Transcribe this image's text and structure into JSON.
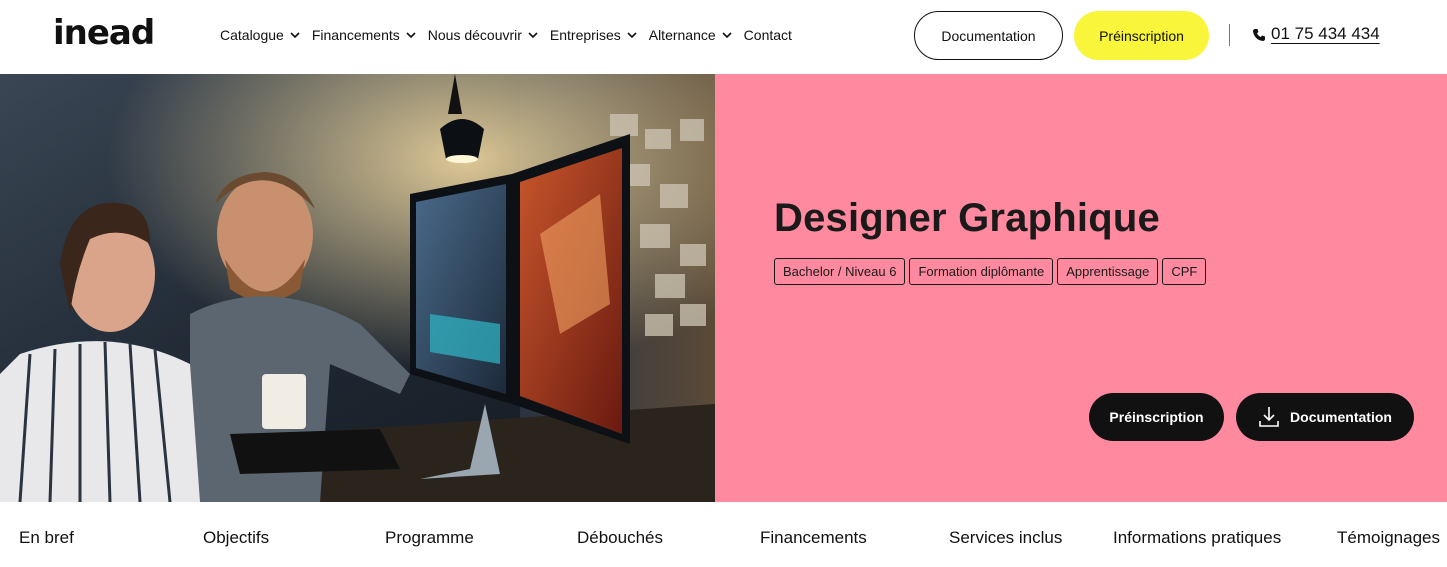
{
  "header": {
    "logo_text": "inead",
    "nav": [
      {
        "label": "Catalogue",
        "dropdown": true
      },
      {
        "label": "Financements",
        "dropdown": true
      },
      {
        "label": "Nous découvrir",
        "dropdown": true
      },
      {
        "label": "Entreprises",
        "dropdown": true
      },
      {
        "label": "Alternance",
        "dropdown": true
      },
      {
        "label": "Contact",
        "dropdown": false
      }
    ],
    "documentation_label": "Documentation",
    "preinscription_label": "Préinscription",
    "phone": "01 75 434 434",
    "accent_yellow": "#f8f53b"
  },
  "hero": {
    "title": "Designer Graphique",
    "tags": [
      "Bachelor / Niveau 6",
      "Formation diplômante",
      "Apprentissage",
      "CPF"
    ],
    "preinscription_label": "Préinscription",
    "documentation_label": "Documentation",
    "panel_color": "#ff8aa0",
    "image_icon": "photo-two-people-at-editing-monitors"
  },
  "tabs": [
    "En bref",
    "Objectifs",
    "Programme",
    "Débouchés",
    "Financements",
    "Services inclus",
    "Informations pratiques",
    "Témoignages"
  ]
}
